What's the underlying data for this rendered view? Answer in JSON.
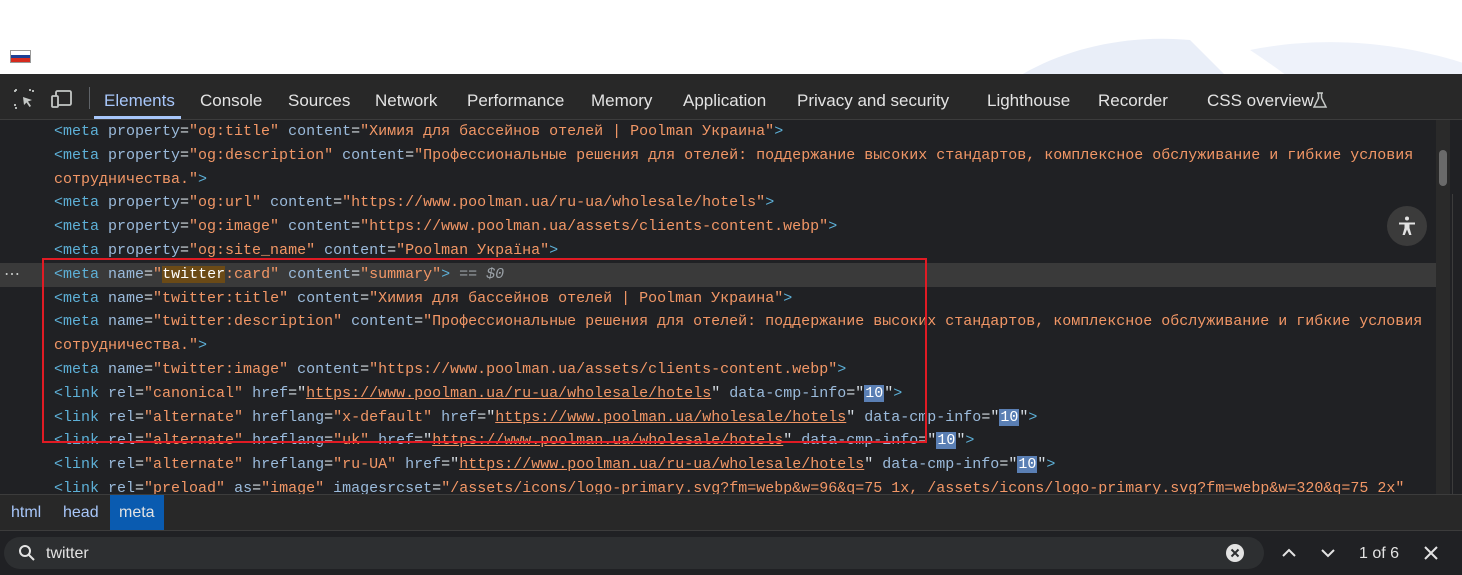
{
  "colors": {
    "tab_active": "#a8c7fa",
    "selection_box": "#e01b24",
    "tag": "#5db0d7",
    "attr": "#9bbbdc",
    "value": "#f29766"
  },
  "tabs": [
    "Elements",
    "Console",
    "Sources",
    "Network",
    "Performance",
    "Memory",
    "Application",
    "Privacy and security",
    "Lighthouse",
    "Recorder",
    "CSS overview"
  ],
  "toolbar_icons": [
    "inspect-icon",
    "device-toggle-icon",
    "lab-flask-icon",
    "accessibility-icon"
  ],
  "lines": [
    [
      [
        "t",
        "<meta "
      ],
      [
        "a",
        "property"
      ],
      [
        "p",
        "="
      ],
      [
        "v",
        "\"og:title\""
      ],
      [
        "p",
        " "
      ],
      [
        "a",
        "content"
      ],
      [
        "p",
        "="
      ],
      [
        "v",
        "\"Химия для бассейнов отелей | Poolman Украина\""
      ],
      [
        "t",
        ">"
      ]
    ],
    [
      [
        "t",
        "<meta "
      ],
      [
        "a",
        "property"
      ],
      [
        "p",
        "="
      ],
      [
        "v",
        "\"og:description\""
      ],
      [
        "p",
        " "
      ],
      [
        "a",
        "content"
      ],
      [
        "p",
        "="
      ],
      [
        "v",
        "\"Профессиональные решения для отелей: поддержание высоких стандартов, комплексное обслуживание и гибкие условия"
      ]
    ],
    [
      [
        "v",
        "сотрудничества.\""
      ],
      [
        "t",
        ">"
      ]
    ],
    [
      [
        "t",
        "<meta "
      ],
      [
        "a",
        "property"
      ],
      [
        "p",
        "="
      ],
      [
        "v",
        "\"og:url\""
      ],
      [
        "p",
        " "
      ],
      [
        "a",
        "content"
      ],
      [
        "p",
        "="
      ],
      [
        "v",
        "\"https://www.poolman.ua/ru-ua/wholesale/hotels\""
      ],
      [
        "t",
        ">"
      ]
    ],
    [
      [
        "t",
        "<meta "
      ],
      [
        "a",
        "property"
      ],
      [
        "p",
        "="
      ],
      [
        "v",
        "\"og:image\""
      ],
      [
        "p",
        " "
      ],
      [
        "a",
        "content"
      ],
      [
        "p",
        "="
      ],
      [
        "v",
        "\"https://www.poolman.ua/assets/clients-content.webp\""
      ],
      [
        "t",
        ">"
      ]
    ],
    [
      [
        "t",
        "<meta "
      ],
      [
        "a",
        "property"
      ],
      [
        "p",
        "="
      ],
      [
        "v",
        "\"og:site_name\""
      ],
      [
        "p",
        " "
      ],
      [
        "a",
        "content"
      ],
      [
        "p",
        "="
      ],
      [
        "v",
        "\"Poolman Україна\""
      ],
      [
        "t",
        ">"
      ]
    ],
    [
      [
        "t",
        "<meta "
      ],
      [
        "a",
        "name"
      ],
      [
        "p",
        "="
      ],
      [
        "v",
        "\""
      ],
      [
        "h",
        "twitter"
      ],
      [
        "v",
        ":card\""
      ],
      [
        "p",
        " "
      ],
      [
        "a",
        "content"
      ],
      [
        "p",
        "="
      ],
      [
        "v",
        "\"summary\""
      ],
      [
        "t",
        ">"
      ],
      [
        "e",
        " == $0"
      ]
    ],
    [
      [
        "t",
        "<meta "
      ],
      [
        "a",
        "name"
      ],
      [
        "p",
        "="
      ],
      [
        "v",
        "\"twitter:title\""
      ],
      [
        "p",
        " "
      ],
      [
        "a",
        "content"
      ],
      [
        "p",
        "="
      ],
      [
        "v",
        "\"Химия для бассейнов отелей | Poolman Украина\""
      ],
      [
        "t",
        ">"
      ]
    ],
    [
      [
        "t",
        "<meta "
      ],
      [
        "a",
        "name"
      ],
      [
        "p",
        "="
      ],
      [
        "v",
        "\"twitter:description\""
      ],
      [
        "p",
        " "
      ],
      [
        "a",
        "content"
      ],
      [
        "p",
        "="
      ],
      [
        "v",
        "\"Профессиональные решения для отелей: поддержание высоких стандартов, комплексное обслуживание и гибкие условия"
      ]
    ],
    [
      [
        "v",
        "сотрудничества.\""
      ],
      [
        "t",
        ">"
      ]
    ],
    [
      [
        "t",
        "<meta "
      ],
      [
        "a",
        "name"
      ],
      [
        "p",
        "="
      ],
      [
        "v",
        "\"twitter:image\""
      ],
      [
        "p",
        " "
      ],
      [
        "a",
        "content"
      ],
      [
        "p",
        "="
      ],
      [
        "v",
        "\"https://www.poolman.ua/assets/clients-content.webp\""
      ],
      [
        "t",
        ">"
      ]
    ],
    [
      [
        "t",
        "<link "
      ],
      [
        "a",
        "rel"
      ],
      [
        "p",
        "="
      ],
      [
        "v",
        "\"canonical\""
      ],
      [
        "p",
        " "
      ],
      [
        "a",
        "href"
      ],
      [
        "p",
        "=\""
      ],
      [
        "l",
        "https://www.poolman.ua/ru-ua/wholesale/hotels"
      ],
      [
        "p",
        "\" "
      ],
      [
        "a",
        "data-cmp-info"
      ],
      [
        "p",
        "=\""
      ],
      [
        "b",
        "10"
      ],
      [
        "p",
        "\""
      ],
      [
        "t",
        ">"
      ]
    ],
    [
      [
        "t",
        "<link "
      ],
      [
        "a",
        "rel"
      ],
      [
        "p",
        "="
      ],
      [
        "v",
        "\"alternate\""
      ],
      [
        "p",
        " "
      ],
      [
        "a",
        "hreflang"
      ],
      [
        "p",
        "="
      ],
      [
        "v",
        "\"x-default\""
      ],
      [
        "p",
        " "
      ],
      [
        "a",
        "href"
      ],
      [
        "p",
        "=\""
      ],
      [
        "l",
        "https://www.poolman.ua/wholesale/hotels"
      ],
      [
        "p",
        "\" "
      ],
      [
        "a",
        "data-cmp-info"
      ],
      [
        "p",
        "=\""
      ],
      [
        "b",
        "10"
      ],
      [
        "p",
        "\""
      ],
      [
        "t",
        ">"
      ]
    ],
    [
      [
        "t",
        "<link "
      ],
      [
        "a",
        "rel"
      ],
      [
        "p",
        "="
      ],
      [
        "v",
        "\"alternate\""
      ],
      [
        "p",
        " "
      ],
      [
        "a",
        "hreflang"
      ],
      [
        "p",
        "="
      ],
      [
        "v",
        "\"uk\""
      ],
      [
        "p",
        " "
      ],
      [
        "a",
        "href"
      ],
      [
        "p",
        "=\""
      ],
      [
        "l",
        "https://www.poolman.ua/wholesale/hotels"
      ],
      [
        "p",
        "\" "
      ],
      [
        "a",
        "data-cmp-info"
      ],
      [
        "p",
        "=\""
      ],
      [
        "b",
        "10"
      ],
      [
        "p",
        "\""
      ],
      [
        "t",
        ">"
      ]
    ],
    [
      [
        "t",
        "<link "
      ],
      [
        "a",
        "rel"
      ],
      [
        "p",
        "="
      ],
      [
        "v",
        "\"alternate\""
      ],
      [
        "p",
        " "
      ],
      [
        "a",
        "hreflang"
      ],
      [
        "p",
        "="
      ],
      [
        "v",
        "\"ru-UA\""
      ],
      [
        "p",
        " "
      ],
      [
        "a",
        "href"
      ],
      [
        "p",
        "=\""
      ],
      [
        "l",
        "https://www.poolman.ua/ru-ua/wholesale/hotels"
      ],
      [
        "p",
        "\" "
      ],
      [
        "a",
        "data-cmp-info"
      ],
      [
        "p",
        "=\""
      ],
      [
        "b",
        "10"
      ],
      [
        "p",
        "\""
      ],
      [
        "t",
        ">"
      ]
    ],
    [
      [
        "t",
        "<link "
      ],
      [
        "a",
        "rel"
      ],
      [
        "p",
        "="
      ],
      [
        "v",
        "\"preload\""
      ],
      [
        "p",
        " "
      ],
      [
        "a",
        "as"
      ],
      [
        "p",
        "="
      ],
      [
        "v",
        "\"image\""
      ],
      [
        "p",
        " "
      ],
      [
        "a",
        "imagesrcset"
      ],
      [
        "p",
        "="
      ],
      [
        "v",
        "\"/assets/icons/logo-primary.svg?fm=webp&w=96&q=75 1x, /assets/icons/logo-primary.svg?fm=webp&w=320&q=75 2x\""
      ]
    ]
  ],
  "selected_line_index": 6,
  "row_menu": "⋯",
  "breadcrumbs": [
    "html",
    "head",
    "meta"
  ],
  "search": {
    "value": "twitter",
    "match_count": "1 of 6"
  }
}
